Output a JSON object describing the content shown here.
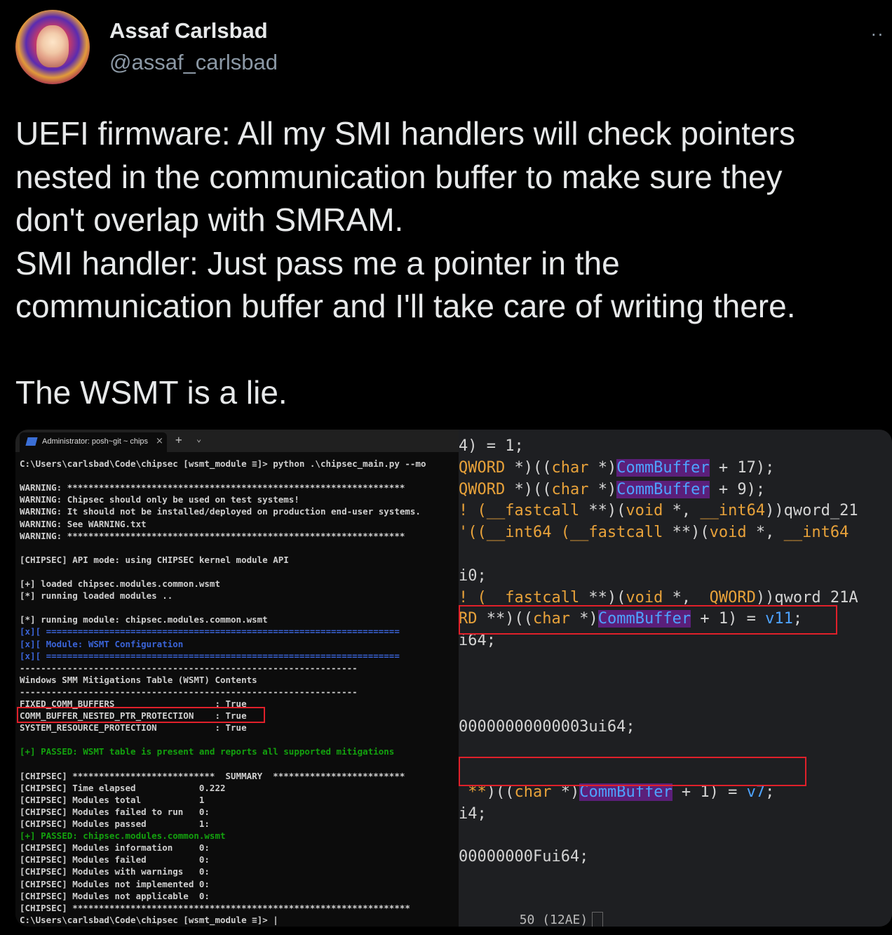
{
  "author": {
    "name": "Assaf Carlsbad",
    "handle": "@assaf_carlsbad",
    "more_icon": "ellipsis-icon"
  },
  "tweet": {
    "lines": [
      "UEFI firmware: All my SMI handlers will check pointers",
      "nested in the communication buffer to make sure they",
      "don't overlap with SMRAM.",
      "SMI handler: Just pass me a pointer in the",
      "communication buffer and I'll take care of writing there.",
      "",
      "The WSMT is a lie."
    ]
  },
  "terminal": {
    "tab_title": "Administrator: posh~git ~ chips",
    "tab_close": "×",
    "new_tab": "+",
    "dropdown": "⌄",
    "lines": [
      "C:\\Users\\carlsbad\\Code\\chipsec [wsmt_module ≡]> python .\\chipsec_main.py --mo",
      "",
      "WARNING: ****************************************************************",
      "WARNING: Chipsec should only be used on test systems!",
      "WARNING: It should not be installed/deployed on production end-user systems.",
      "WARNING: See WARNING.txt",
      "WARNING: ****************************************************************",
      "",
      "[CHIPSEC] API mode: using CHIPSEC kernel module API",
      "",
      "[+] loaded chipsec.modules.common.wsmt",
      "[*] running loaded modules ..",
      "",
      "[*] running module: chipsec.modules.common.wsmt",
      "[x][ ===================================================================",
      "[x][ Module: WSMT Configuration",
      "[x][ ===================================================================",
      "----------------------------------------------------------------",
      "Windows SMM Mitigations Table (WSMT) Contents",
      "----------------------------------------------------------------",
      "FIXED_COMM_BUFFERS                   : True",
      "COMM_BUFFER_NESTED_PTR_PROTECTION    : True",
      "SYSTEM_RESOURCE_PROTECTION           : True",
      "",
      "[+] PASSED: WSMT table is present and reports all supported mitigations",
      "",
      "[CHIPSEC] ***************************  SUMMARY  *************************",
      "[CHIPSEC] Time elapsed            0.222",
      "[CHIPSEC] Modules total           1",
      "[CHIPSEC] Modules failed to run   0:",
      "[CHIPSEC] Modules passed          1:",
      "[+] PASSED: chipsec.modules.common.wsmt",
      "[CHIPSEC] Modules information     0:",
      "[CHIPSEC] Modules failed          0:",
      "[CHIPSEC] Modules with warnings   0:",
      "[CHIPSEC] Modules not implemented 0:",
      "[CHIPSEC] Modules not applicable  0:",
      "[CHIPSEC] ****************************************************************",
      "C:\\Users\\carlsbad\\Code\\chipsec [wsmt_module ≡]> |"
    ],
    "line_colors": {
      "14": "blue",
      "15": "blue",
      "16": "blue",
      "24": "green",
      "31": "green"
    }
  },
  "code": {
    "lines": [
      {
        "t": [
          [
            "",
            "4) = 1;"
          ]
        ]
      },
      {
        "t": [
          [
            "kw",
            "QWORD"
          ],
          [
            "",
            " *)(("
          ],
          [
            "kw",
            "char"
          ],
          [
            "",
            " *)"
          ],
          [
            "cb",
            "CommBuffer"
          ],
          [
            "",
            " + 17);"
          ]
        ]
      },
      {
        "t": [
          [
            "kw",
            "QWORD"
          ],
          [
            "",
            " *)(("
          ],
          [
            "kw",
            "char"
          ],
          [
            "",
            " *)"
          ],
          [
            "cb",
            "CommBuffer"
          ],
          [
            "",
            " + 9);"
          ]
        ]
      },
      {
        "t": [
          [
            "kw",
            "! (__fastcall"
          ],
          [
            "",
            " **)("
          ],
          [
            "kw",
            "void"
          ],
          [
            "",
            " *, "
          ],
          [
            "kw",
            "__int64"
          ],
          [
            "",
            "))qword_21"
          ]
        ]
      },
      {
        "t": [
          [
            "kw",
            "'((__int64 (__fastcall"
          ],
          [
            "",
            " **)("
          ],
          [
            "kw",
            "void"
          ],
          [
            "",
            " *, "
          ],
          [
            "kw",
            "__int64"
          ],
          [
            ",",
            ""
          ]
        ]
      },
      {
        "t": [
          [
            "",
            ""
          ]
        ]
      },
      {
        "t": [
          [
            "",
            "i0;"
          ]
        ]
      },
      {
        "t": [
          [
            "kw",
            "! (  fastcall"
          ],
          [
            "",
            " **)("
          ],
          [
            "kw",
            "void"
          ],
          [
            "",
            " *,  "
          ],
          [
            "kw",
            "QWORD"
          ],
          [
            "",
            "))qword_21A"
          ]
        ]
      },
      {
        "t": [
          [
            "kw",
            "RD"
          ],
          [
            "",
            " **)(("
          ],
          [
            "kw",
            "char"
          ],
          [
            "",
            " *)"
          ],
          [
            "cb",
            "CommBuffer"
          ],
          [
            "",
            " + 1) = "
          ],
          [
            "vv",
            "v11"
          ],
          [
            "",
            ";"
          ]
        ]
      },
      {
        "t": [
          [
            "",
            "i64;"
          ]
        ]
      },
      {
        "t": [
          [
            "",
            ""
          ]
        ]
      },
      {
        "t": [
          [
            "",
            ""
          ]
        ]
      },
      {
        "t": [
          [
            "",
            ""
          ]
        ]
      },
      {
        "t": [
          [
            "",
            "00000000000003ui64;"
          ]
        ]
      },
      {
        "t": [
          [
            "",
            ""
          ]
        ]
      },
      {
        "t": [
          [
            "",
            ""
          ]
        ]
      },
      {
        "t": [
          [
            "kw",
            " **"
          ],
          [
            "",
            ")(("
          ],
          [
            "kw",
            "char"
          ],
          [
            "",
            " *)"
          ],
          [
            "cb",
            "CommBuffer"
          ],
          [
            "",
            " + 1) = "
          ],
          [
            "vv",
            "v7"
          ],
          [
            "",
            ";"
          ]
        ]
      },
      {
        "t": [
          [
            "",
            "i4;"
          ]
        ]
      },
      {
        "t": [
          [
            "",
            ""
          ]
        ]
      },
      {
        "t": [
          [
            "",
            "00000000Fui64;"
          ]
        ]
      }
    ],
    "status": "50 (12AE)"
  }
}
